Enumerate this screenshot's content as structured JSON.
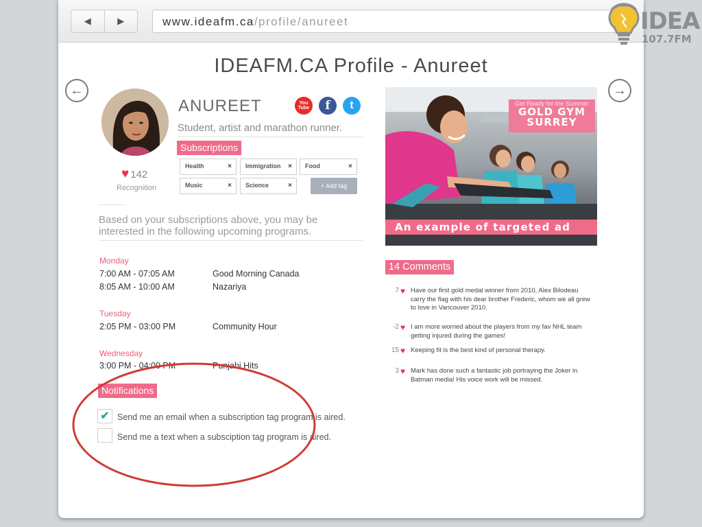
{
  "browser": {
    "back_label": "◀",
    "forward_label": "▶",
    "url_host": "www.ideafm.ca",
    "url_path": "/profile/anureet"
  },
  "logo": {
    "name": "IDEA",
    "frequency": "107.7FM"
  },
  "page": {
    "title": "IDEAFM.CA Profile - Anureet",
    "prev_arrow": "←",
    "next_arrow": "→"
  },
  "profile": {
    "name": "ANUREET",
    "tagline": "Student, artist and marathon runner.",
    "recognition_count": "142",
    "recognition_label": "Recognition",
    "social": [
      {
        "name": "youtube",
        "label": "You\nTube",
        "color": "#e52d27"
      },
      {
        "name": "facebook",
        "label": "f",
        "color": "#3b5998"
      },
      {
        "name": "twitter",
        "label": "t",
        "color": "#2aa3ef"
      }
    ]
  },
  "subscriptions": {
    "header": "Subscriptions",
    "tags": [
      "Health",
      "Immigration",
      "Food",
      "Music",
      "Science"
    ],
    "remove_icon": "×",
    "add_tag_label": "+  Add tag"
  },
  "programs": {
    "intro": "Based on your subscriptions above, you may be interested in the following upcoming programs.",
    "days": [
      {
        "day": "Monday",
        "slots": [
          {
            "time": "7:00 AM - 07:05 AM",
            "show": "Good Morning Canada"
          },
          {
            "time": "8:05 AM - 10:00 AM",
            "show": "Nazariya"
          }
        ]
      },
      {
        "day": "Tuesday",
        "slots": [
          {
            "time": "2:05 PM - 03:00 PM",
            "show": "Community Hour"
          }
        ]
      },
      {
        "day": "Wednesday",
        "slots": [
          {
            "time": "3:00 PM - 04:00 PM",
            "show": "Punjabi Hits"
          }
        ]
      }
    ]
  },
  "notifications": {
    "header": "Notifications",
    "items": [
      {
        "label": "Send me an email when a subscription tag program is aired.",
        "checked": true
      },
      {
        "label": "Send me a text when a subsciption tag program is aired.",
        "checked": false
      }
    ],
    "check_mark": "✔"
  },
  "ad": {
    "top_small": "Get Ready for the Summer",
    "top_line1": "GOLD GYM",
    "top_line2": "SURREY",
    "bottom": "An example of targeted ad"
  },
  "comments": {
    "header": "14 Comments",
    "items": [
      {
        "score": "7",
        "text": "Have our first gold medal winner from 2010, Alex Bilodeau carry the flag with his dear brother Frederic, whom we all grew to love in Vancouver 2010."
      },
      {
        "score": "-2",
        "text": "I am more worried about the players from my fav NHL team getting injured during the games!"
      },
      {
        "score": "15",
        "text": "Keeping fit is the best kind of personal therapy."
      },
      {
        "score": "3",
        "text": "Mark has done such a fantastic job portraying the Joker in Batman media! His voice work will be missed."
      }
    ]
  },
  "colors": {
    "accent_pink": "#f06a8a",
    "heart_red": "#e8334a",
    "check_teal": "#2fa8a8",
    "annotation_red": "#d03a33"
  }
}
